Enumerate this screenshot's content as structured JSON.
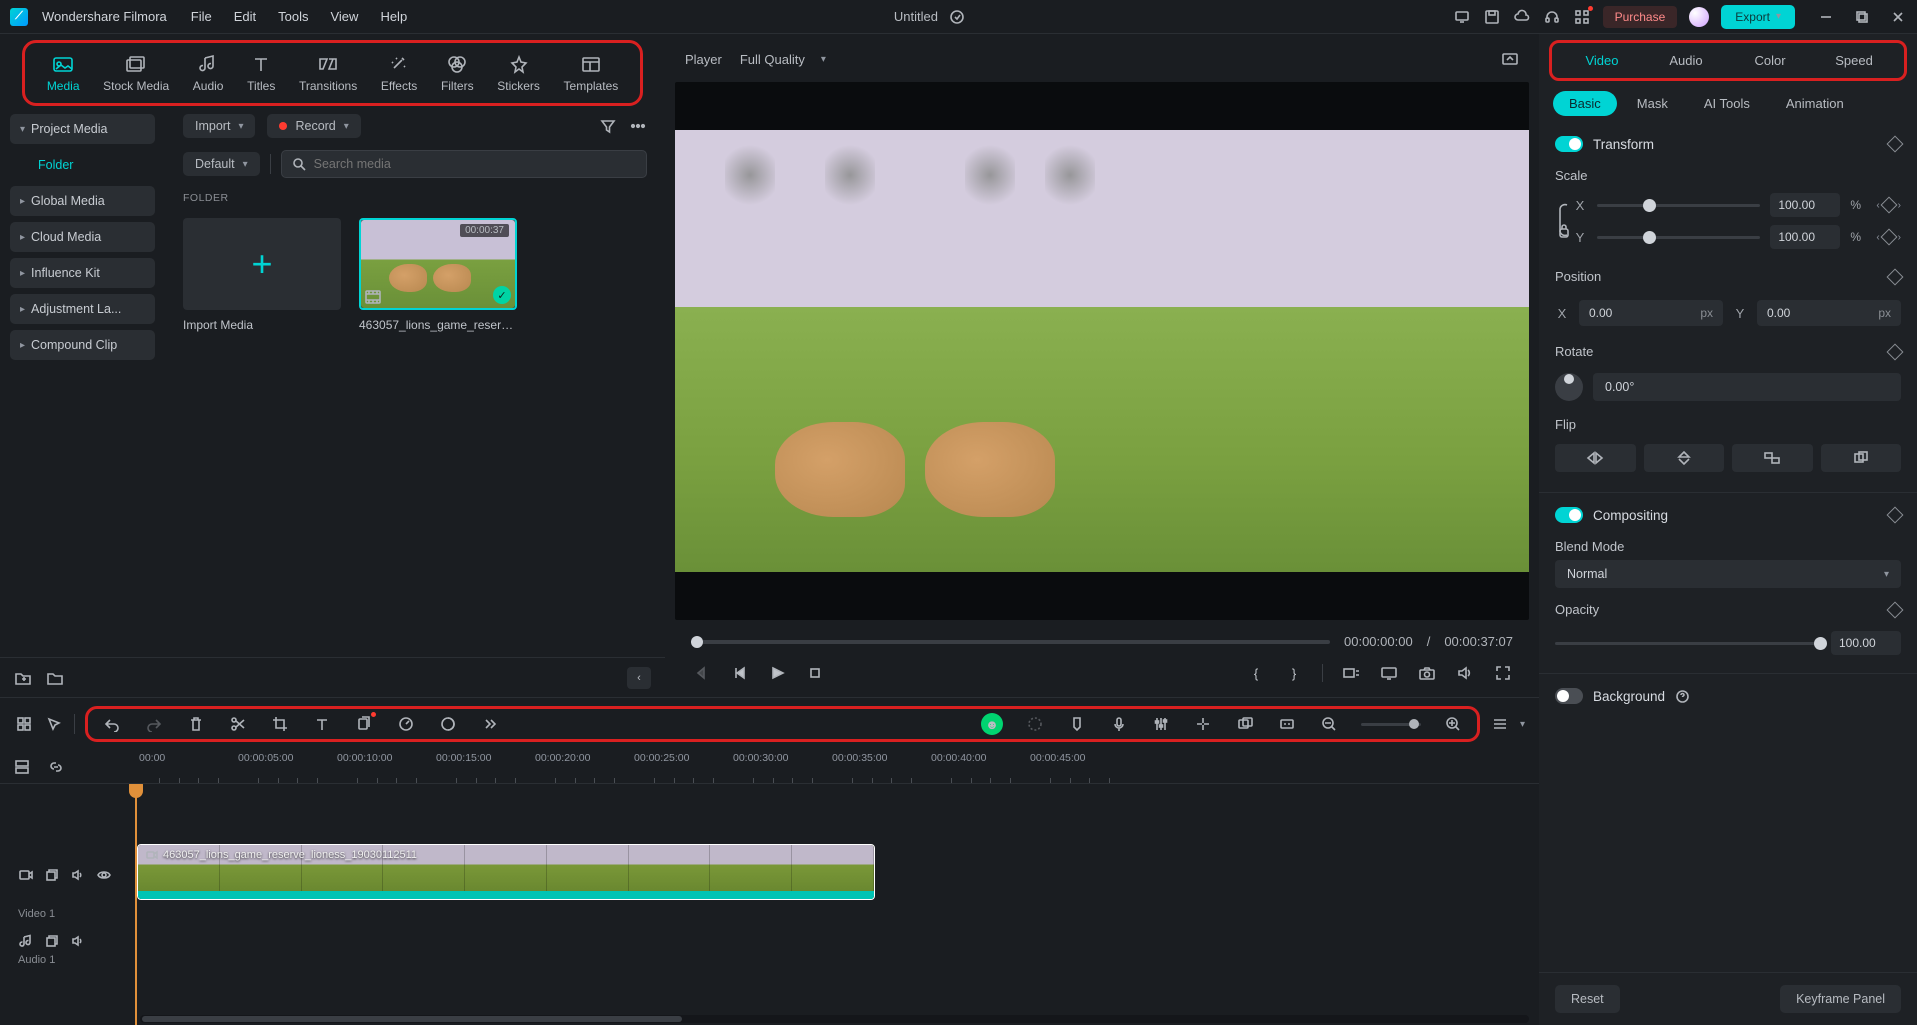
{
  "app": {
    "name": "Wondershare Filmora",
    "menus": [
      "File",
      "Edit",
      "Tools",
      "View",
      "Help"
    ],
    "title": "Untitled",
    "purchase": "Purchase",
    "export": "Export"
  },
  "topTabs": [
    {
      "id": "media",
      "label": "Media",
      "icon": "media-icon"
    },
    {
      "id": "stock",
      "label": "Stock Media",
      "icon": "stock-icon"
    },
    {
      "id": "audio",
      "label": "Audio",
      "icon": "audio-icon"
    },
    {
      "id": "titles",
      "label": "Titles",
      "icon": "titles-icon"
    },
    {
      "id": "transitions",
      "label": "Transitions",
      "icon": "transitions-icon"
    },
    {
      "id": "effects",
      "label": "Effects",
      "icon": "effects-icon"
    },
    {
      "id": "filters",
      "label": "Filters",
      "icon": "filters-icon"
    },
    {
      "id": "stickers",
      "label": "Stickers",
      "icon": "stickers-icon"
    },
    {
      "id": "templates",
      "label": "Templates",
      "icon": "templates-icon"
    }
  ],
  "sidebar": {
    "items": [
      {
        "label": "Project Media",
        "expanded": true
      },
      {
        "label": "Global Media"
      },
      {
        "label": "Cloud Media"
      },
      {
        "label": "Influence Kit"
      },
      {
        "label": "Adjustment La..."
      },
      {
        "label": "Compound Clip"
      }
    ],
    "sub": "Folder"
  },
  "content": {
    "importLabel": "Import",
    "recordLabel": "Record",
    "defaultLabel": "Default",
    "searchPlaceholder": "Search media",
    "folderHeader": "FOLDER",
    "thumbs": [
      {
        "label": "Import Media",
        "type": "add"
      },
      {
        "label": "463057_lions_game_reserve_...",
        "type": "clip",
        "duration": "00:00:37",
        "selected": true
      }
    ]
  },
  "player": {
    "headLabel": "Player",
    "quality": "Full Quality",
    "current": "00:00:00:00",
    "sep": "/",
    "total": "00:00:37:07"
  },
  "inspector": {
    "tabs": [
      "Video",
      "Audio",
      "Color",
      "Speed"
    ],
    "subtabs": [
      "Basic",
      "Mask",
      "AI Tools",
      "Animation"
    ],
    "transform": {
      "title": "Transform",
      "scale": {
        "label": "Scale",
        "x": "100.00",
        "y": "100.00",
        "unit": "%"
      },
      "position": {
        "label": "Position",
        "x": "0.00",
        "y": "0.00",
        "unit": "px"
      },
      "rotate": {
        "label": "Rotate",
        "value": "0.00°"
      },
      "flip": {
        "label": "Flip"
      }
    },
    "compositing": {
      "title": "Compositing",
      "blend": {
        "label": "Blend Mode",
        "value": "Normal"
      },
      "opacity": {
        "label": "Opacity",
        "value": "100.00"
      }
    },
    "background": {
      "title": "Background"
    },
    "reset": "Reset",
    "keyframe": "Keyframe Panel"
  },
  "timeline": {
    "ruler": [
      "00:00",
      "00:00:05:00",
      "00:00:10:00",
      "00:00:15:00",
      "00:00:20:00",
      "00:00:25:00",
      "00:00:30:00",
      "00:00:35:00",
      "00:00:40:00",
      "00:00:45:00"
    ],
    "videoTrack": "Video 1",
    "audioTrack": "Audio 1",
    "clipName": "463057_lions_game_reserve_lioness_19030112511"
  }
}
